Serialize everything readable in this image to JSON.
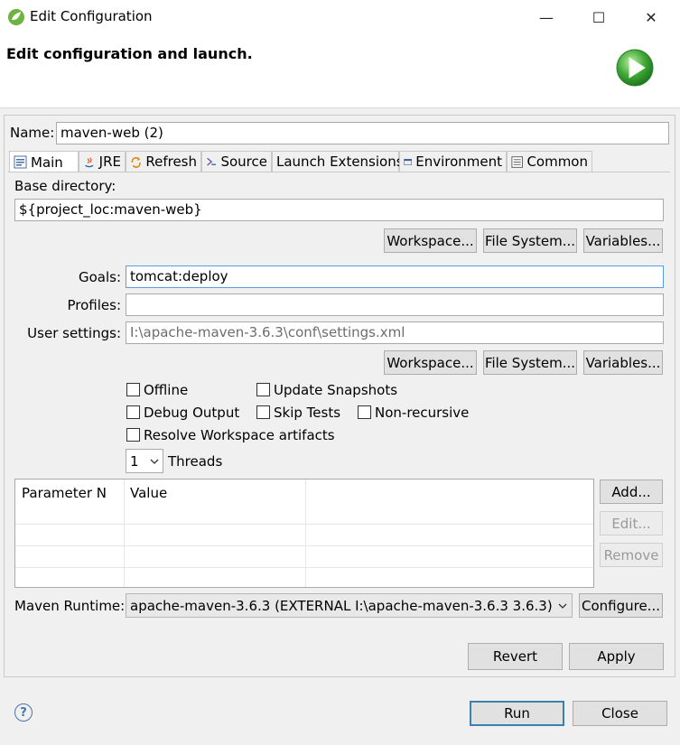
{
  "window": {
    "title": "Edit Configuration",
    "minimize": "—",
    "maximize": "☐",
    "close": "✕"
  },
  "header": {
    "title": "Edit configuration and launch."
  },
  "name": {
    "label": "Name:",
    "value": "maven-web (2)"
  },
  "tabs": [
    {
      "label": "Main",
      "icon": "main-tab-icon"
    },
    {
      "label": "JRE",
      "icon": "jre-tab-icon"
    },
    {
      "label": "Refresh",
      "icon": "refresh-tab-icon"
    },
    {
      "label": "Source",
      "icon": "source-tab-icon"
    },
    {
      "label": "Launch Extensions",
      "icon": ""
    },
    {
      "label": "Environment",
      "icon": "environment-tab-icon"
    },
    {
      "label": "Common",
      "icon": "common-tab-icon"
    }
  ],
  "main": {
    "base_dir_label": "Base directory:",
    "base_dir_value": "${project_loc:maven-web}",
    "workspace_btn": "Workspace...",
    "filesystem_btn": "File System...",
    "variables_btn": "Variables...",
    "goals_label": "Goals:",
    "goals_value": "tomcat:deploy",
    "profiles_label": "Profiles:",
    "profiles_value": "",
    "user_settings_label": "User settings:",
    "user_settings_value": "I:\\apache-maven-3.6.3\\conf\\settings.xml",
    "workspace_btn2": "Workspace...",
    "filesystem_btn2": "File System...",
    "variables_btn2": "Variables...",
    "offline": "Offline",
    "update_snapshots": "Update Snapshots",
    "debug_output": "Debug Output",
    "skip_tests": "Skip Tests",
    "non_recursive": "Non-recursive",
    "resolve_workspace": "Resolve Workspace artifacts",
    "threads_value": "1",
    "threads_label": "Threads",
    "table": {
      "col_name": "Parameter N",
      "col_value": "Value"
    },
    "add_btn": "Add...",
    "edit_btn": "Edit...",
    "remove_btn": "Remove",
    "runtime_label": "Maven Runtime:",
    "runtime_value": "apache-maven-3.6.3 (EXTERNAL I:\\apache-maven-3.6.3 3.6.3)",
    "configure_btn": "Configure..."
  },
  "footer": {
    "revert": "Revert",
    "apply": "Apply",
    "run": "Run",
    "close": "Close",
    "help": "?"
  },
  "colors": {
    "accent": "#3c7fb1",
    "run_icon": "#3fa535"
  }
}
